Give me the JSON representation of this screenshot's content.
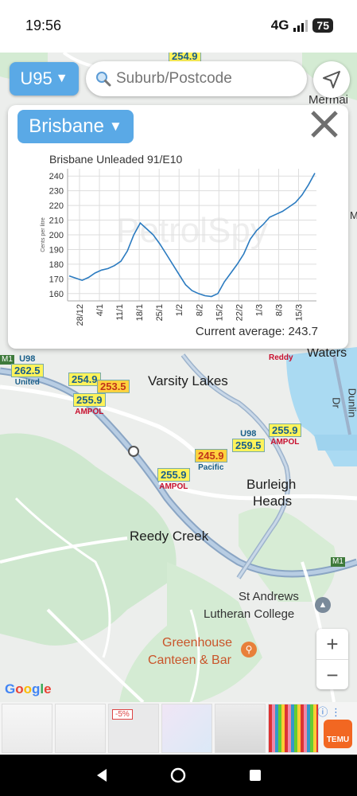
{
  "status": {
    "time": "19:56",
    "network": "4G",
    "battery": "75"
  },
  "controls": {
    "fuel_type": "U95",
    "search_placeholder": "Suburb/Postcode",
    "city": "Brisbane"
  },
  "chart_data": {
    "type": "line",
    "title": "Brisbane Unleaded 91/E10",
    "ylabel": "Cents per litre",
    "xlabel": "",
    "ylim": [
      155,
      245
    ],
    "yticks": [
      160,
      170,
      180,
      190,
      200,
      210,
      220,
      230,
      240
    ],
    "x_tick_labels": [
      "28/12",
      "4/1",
      "11/1",
      "18/1",
      "25/1",
      "1/2",
      "8/2",
      "15/2",
      "22/2",
      "1/3",
      "8/3",
      "15/3"
    ],
    "series": [
      {
        "values": [
          172,
          170.5,
          169,
          171,
          174,
          176,
          177,
          179,
          182,
          189,
          200,
          208,
          204,
          200,
          194,
          187,
          180,
          173,
          166,
          162,
          160,
          158.5,
          158,
          160,
          168,
          174,
          180,
          187,
          197,
          203,
          207,
          212,
          214,
          216,
          219,
          222,
          227,
          234,
          242
        ]
      }
    ],
    "watermark": "PetrolSpy",
    "grid": true
  },
  "current_average": {
    "label": "Current average:",
    "value": "243.7"
  },
  "map": {
    "labels": {
      "varsity": "Varsity Lakes",
      "burleigh_1": "Burleigh",
      "burleigh_2": "Heads",
      "reedy": "Reedy Creek",
      "st_andrews_1": "St Andrews",
      "st_andrews_2": "Lutheran College",
      "greenhouse_1": "Greenhouse",
      "greenhouse_2": "Canteen & Bar",
      "waters": "Waters",
      "dunlin": "Dunlin Dr",
      "mermaid": "Mermai",
      "m1_a": "M1",
      "m1_b": "M1",
      "m1_c": "M1",
      "google": "Google"
    },
    "pins": [
      {
        "grade": "U98",
        "price": "262.5",
        "brand": "United"
      },
      {
        "grade": "",
        "price": "254.9",
        "brand": ""
      },
      {
        "grade": "",
        "price": "255.9",
        "brand": "AMPOL"
      },
      {
        "grade": "",
        "price": "253.5",
        "brand": ""
      },
      {
        "grade": "U98",
        "price": "259.5",
        "brand": ""
      },
      {
        "grade": "",
        "price": "255.9",
        "brand": "AMPOL"
      },
      {
        "grade": "",
        "price": "245.9",
        "brand": "Pacific"
      },
      {
        "grade": "",
        "price": "255.9",
        "brand": "AMPOL"
      },
      {
        "grade": "",
        "price": "254.9",
        "brand": ""
      }
    ],
    "reddy": "Reddy"
  },
  "ads": {
    "badge": "-5%",
    "info": "ⓘ ⋮",
    "temu": "TEMU"
  }
}
